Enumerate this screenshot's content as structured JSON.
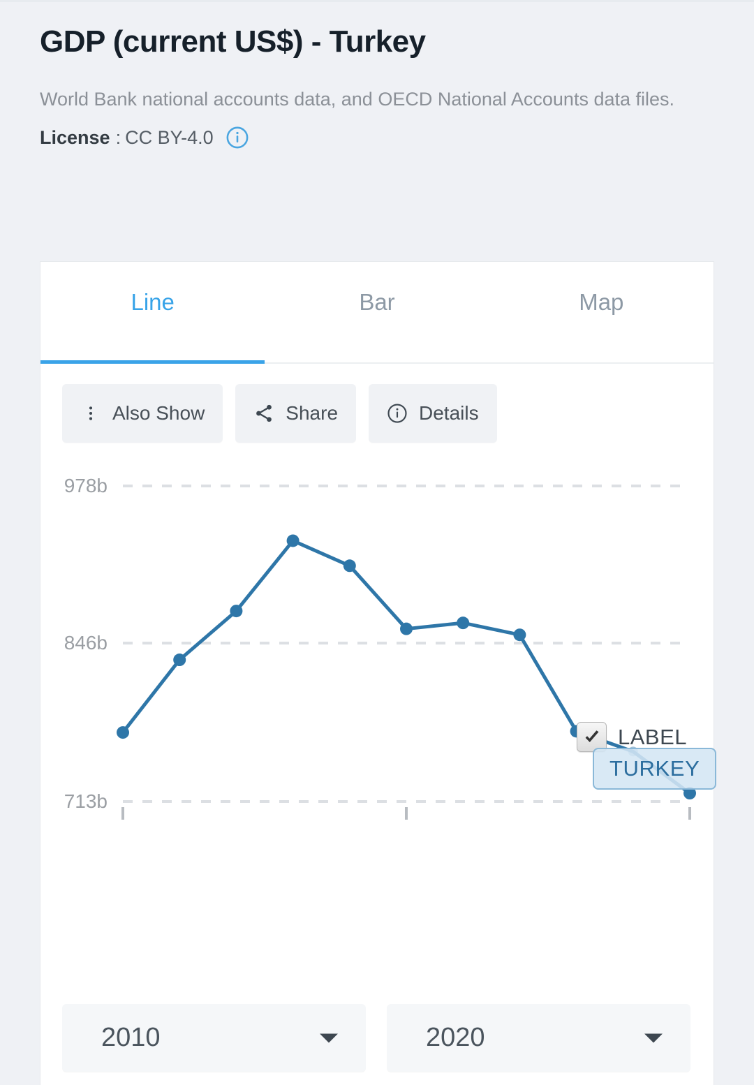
{
  "header": {
    "title": "GDP (current US$) - Turkey",
    "source": "World Bank national accounts data, and OECD National Accounts data files.",
    "license_label": "License",
    "license_separator": ":",
    "license_value": "CC BY-4.0",
    "info_icon": "info-circle-icon"
  },
  "tabs": [
    {
      "label": "Line",
      "active": true
    },
    {
      "label": "Bar",
      "active": false
    },
    {
      "label": "Map",
      "active": false
    }
  ],
  "toolbar": [
    {
      "label": "Also Show",
      "icon": "kebab-menu-icon"
    },
    {
      "label": "Share",
      "icon": "share-icon"
    },
    {
      "label": "Details",
      "icon": "info-circle-icon"
    }
  ],
  "label_toggle": {
    "text": "LABEL",
    "checked": true
  },
  "range": {
    "start_year": "2010",
    "end_year": "2020"
  },
  "colors": {
    "accent": "#3aa3e8",
    "line": "#2e76a8",
    "point": "#2e76a8",
    "grid": "#dcdfe3",
    "axis_text": "#9a9ea3",
    "label_fill": "#d4e6f4",
    "label_border": "#7fb2d6",
    "label_text": "#2b6d9e",
    "page_bg": "#eff1f5",
    "card_bg": "#ffffff"
  },
  "chart_data": {
    "type": "line",
    "title": "GDP (current US$) - Turkey",
    "xlabel": "",
    "ylabel": "",
    "series_label": "TURKEY",
    "unit": "b",
    "ytick_labels": [
      "978b",
      "846b",
      "713b"
    ],
    "ytick_values": [
      978,
      846,
      713
    ],
    "ylim": [
      713,
      978
    ],
    "grid": true,
    "legend_position": "none",
    "x": [
      2010,
      2011,
      2012,
      2013,
      2014,
      2015,
      2016,
      2017,
      2018,
      2019,
      2020
    ],
    "xlim": [
      2010,
      2020
    ],
    "xtick_values": [
      2010,
      2015,
      2020
    ],
    "series": [
      {
        "name": "TURKEY",
        "values": [
          771,
          832,
          873,
          932,
          911,
          858,
          863,
          853,
          772,
          755,
          720
        ]
      }
    ]
  }
}
